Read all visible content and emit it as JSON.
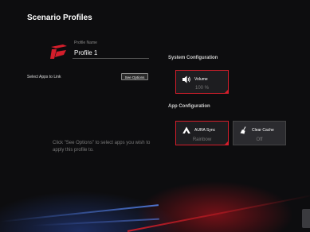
{
  "page": {
    "title": "Scenario Profiles"
  },
  "profile": {
    "name_label": "Profile Name",
    "name_value": "Profile 1"
  },
  "apps": {
    "select_label": "Select Apps to Link",
    "see_options_label": "See Options",
    "hint": "Click \"See Options\" to select apps you wish to apply this profile to."
  },
  "system_config": {
    "title": "System Configuration",
    "tiles": [
      {
        "name": "Volume",
        "value": "100 %",
        "icon": "speaker-icon"
      }
    ]
  },
  "app_config": {
    "title": "App Configuration",
    "tiles": [
      {
        "name": "AURA Sync",
        "value": "Rainbow",
        "icon": "aura-icon"
      },
      {
        "name": "Clear Cache",
        "value": "Off",
        "icon": "broom-icon"
      }
    ]
  },
  "colors": {
    "accent": "#d41e2b",
    "background": "#0d0d0f",
    "tile": "#1d1d20"
  }
}
